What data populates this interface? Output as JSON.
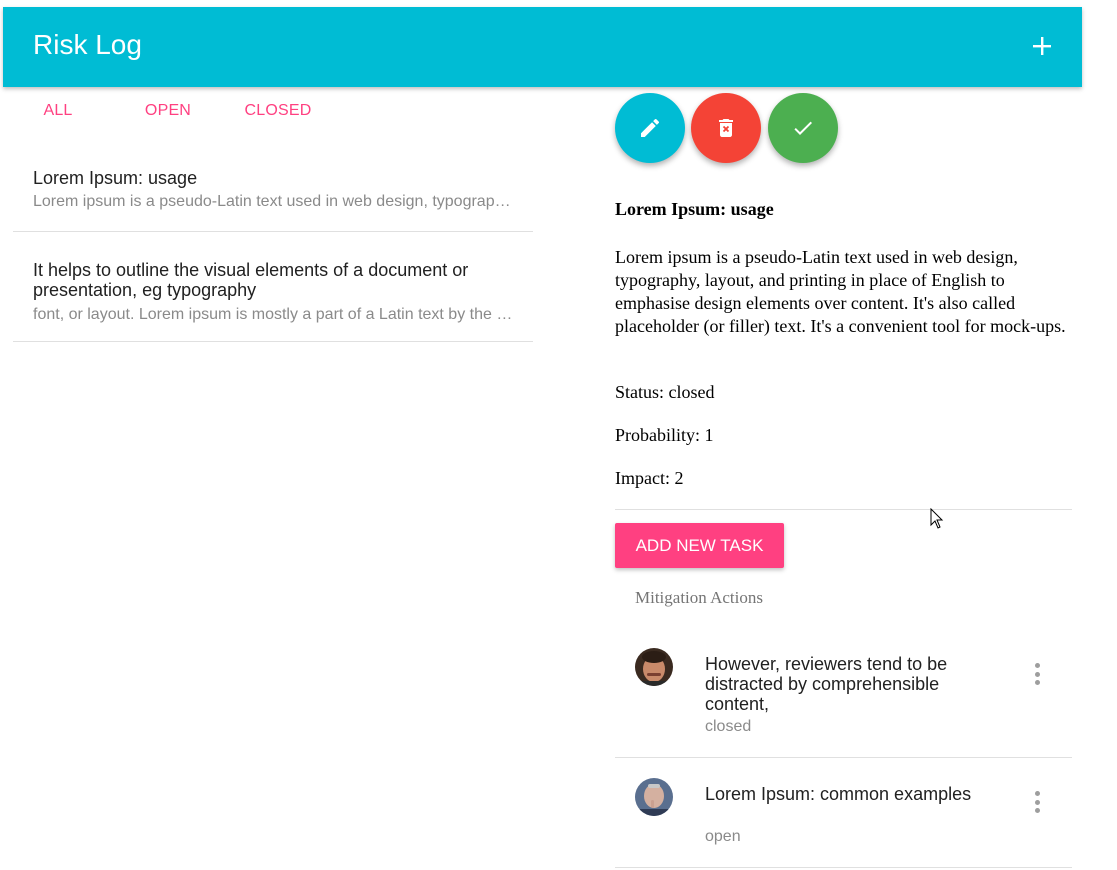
{
  "app": {
    "title": "Risk Log"
  },
  "toolbar": {
    "add_icon": "plus-icon"
  },
  "tabs": [
    {
      "label": "ALL"
    },
    {
      "label": "OPEN"
    },
    {
      "label": "CLOSED"
    }
  ],
  "risks": [
    {
      "title": "Lorem Ipsum: usage",
      "summary": "Lorem ipsum is a pseudo-Latin text used in web design, typography, layout, and printing in place of English to emphasise design elements over content."
    },
    {
      "title": "It helps to outline the visual elements of a document or presentation, eg typography",
      "summary": "font, or layout. Lorem ipsum is mostly a part of a Latin text by the classical author and philosopher Cicero."
    }
  ],
  "actions": {
    "edit_icon": "pencil-icon",
    "delete_icon": "trash-icon",
    "done_icon": "check-icon",
    "colors": {
      "edit": "#00bcd4",
      "delete": "#f44336",
      "done": "#4caf50"
    }
  },
  "detail": {
    "title": "Lorem Ipsum: usage",
    "description": "Lorem ipsum is a pseudo-Latin text used in web design, typography, layout, and printing in place of English to emphasise design elements over content. It's also called placeholder (or filler) text. It's a convenient tool for mock-ups.",
    "status": "Status: closed",
    "probability": "Probability: 1",
    "impact": "Impact: 2"
  },
  "add_task_label": "ADD NEW TASK",
  "mitigation": {
    "header": "Mitigation Actions",
    "tasks": [
      {
        "title": "However, reviewers tend to be distracted by comprehensible content,",
        "status": "closed"
      },
      {
        "title": "Lorem Ipsum: common examples",
        "status": "open"
      }
    ]
  },
  "colors": {
    "primary": "#00bcd4",
    "accent": "#ff4081"
  }
}
